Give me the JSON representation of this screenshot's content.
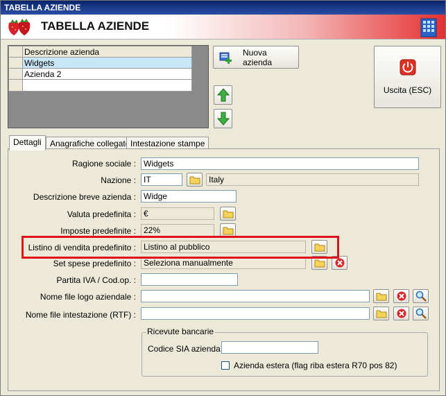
{
  "window": {
    "title": "TABELLA AZIENDE"
  },
  "banner": {
    "title": "TABELLA AZIENDE"
  },
  "grid": {
    "header": "Descrizione azienda",
    "rows": [
      "Widgets",
      "Azienda 2"
    ]
  },
  "buttons": {
    "new_company": "Nuova azienda",
    "exit": "Uscita (ESC)"
  },
  "tabs": [
    "Dettagli",
    "Anagrafiche collegate",
    "Intestazione stampe"
  ],
  "form": {
    "ragione_sociale": {
      "label": "Ragione sociale :",
      "value": "Widgets"
    },
    "nazione": {
      "label": "Nazione :",
      "code": "IT",
      "name": "Italy"
    },
    "descrizione_breve": {
      "label": "Descrizione breve azienda :",
      "value": "Widge"
    },
    "valuta": {
      "label": "Valuta predefinita :",
      "value": "€"
    },
    "imposte": {
      "label": "Imposte predefinite :",
      "value": "22%"
    },
    "listino": {
      "label": "Listino di vendita predefinito :",
      "value": "Listino al pubblico"
    },
    "set_spese": {
      "label": "Set spese predefinito :",
      "value": "Seleziona manualmente"
    },
    "partita_iva": {
      "label": "Partita IVA / Cod.op. :",
      "value": ""
    },
    "logo_file": {
      "label": "Nome file logo aziendale :",
      "value": ""
    },
    "intestazione_file": {
      "label": "Nome file intestazione (RTF) :",
      "value": ""
    }
  },
  "ricevute": {
    "title": "Ricevute bancarie",
    "sia_label": "Codice SIA azienda :",
    "sia_value": "",
    "estera_label": "Azienda estera (flag riba estera R70 pos 82)"
  },
  "colors": {
    "highlight": "#e0101a",
    "exit_icon": "#e03020",
    "arrow": "#3cb043"
  }
}
